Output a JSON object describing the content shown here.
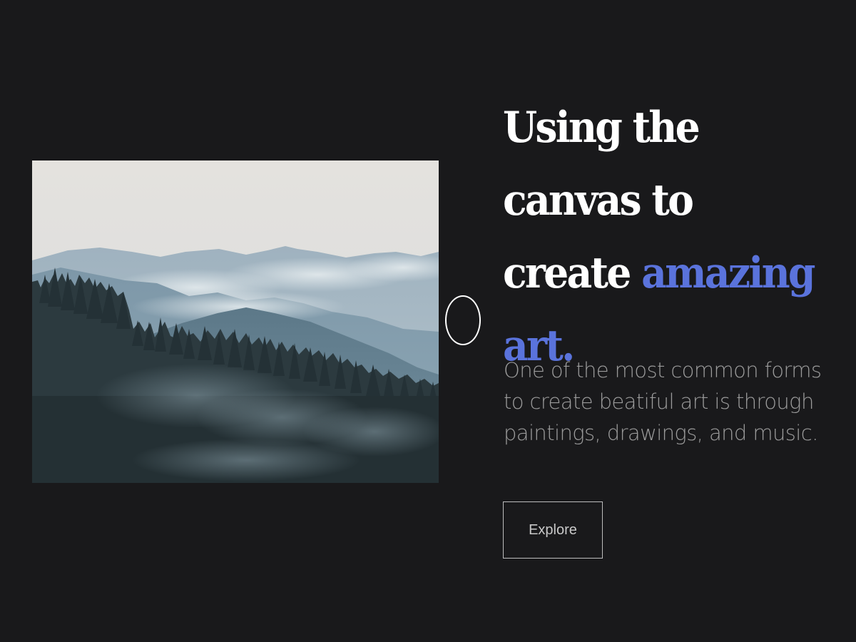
{
  "hero": {
    "heading_part1": "Using the canvas to create ",
    "heading_accent": "amazing art.",
    "description": "One of the most common forms to create beatiful art is through paintings, drawings, and music.",
    "button_label": "Explore"
  },
  "image": {
    "subject": "misty-mountain-forest"
  },
  "icons": {
    "cursor": "circle-cursor-icon"
  },
  "colors": {
    "background": "#19191b",
    "heading": "#ffffff",
    "accent": "#5a73dc",
    "body_text": "#9b9b9b",
    "button_border": "#bdbdbd"
  }
}
